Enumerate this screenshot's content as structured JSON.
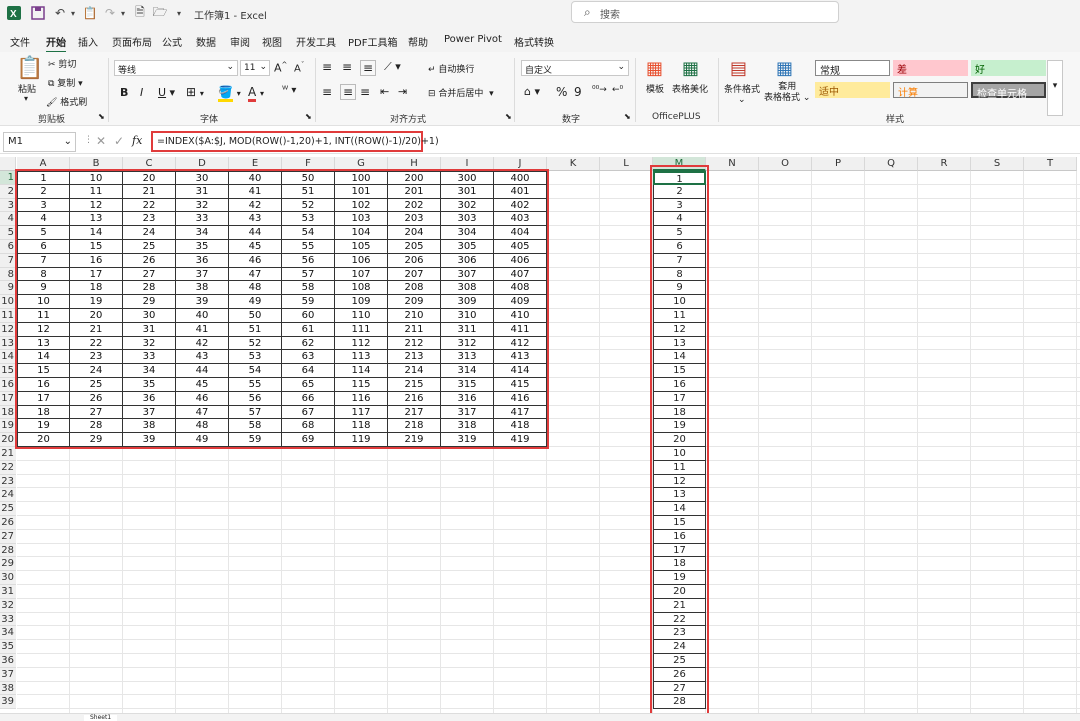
{
  "titlebar": {
    "title": "工作簿1 - Excel",
    "search_placeholder": "搜索",
    "icons": [
      "excel-logo",
      "save-icon",
      "undo-icon",
      "clipboard-icon",
      "redo-icon",
      "file-icon",
      "folder-icon",
      "chevron-down-icon"
    ]
  },
  "menu": [
    "文件",
    "开始",
    "插入",
    "页面布局",
    "公式",
    "数据",
    "审阅",
    "视图",
    "开发工具",
    "PDF工具箱",
    "帮助",
    "Power Pivot",
    "格式转换"
  ],
  "ribbon": {
    "clipboard": {
      "paste": "粘贴",
      "cut": "剪切",
      "copy": "复制",
      "format_painter": "格式刷",
      "label": "剪贴板"
    },
    "font": {
      "name": "等线",
      "size": "11",
      "label": "字体",
      "bold": "B",
      "italic": "I",
      "underline": "U"
    },
    "align": {
      "wrap": "自动换行",
      "merge": "合并后居中",
      "label": "对齐方式"
    },
    "number": {
      "format": "自定义",
      "label": "数字",
      "percent": "%",
      "comma": "9"
    },
    "officeplus": {
      "template": "模板",
      "beautify": "表格美化",
      "label": "OfficePLUS"
    },
    "styles": {
      "cond_format": "条件格式",
      "table_format_1": "套用",
      "table_format_2": "表格格式",
      "label": "样式",
      "items": [
        {
          "text": "常规",
          "bg": "#ffffff",
          "color": "#222222"
        },
        {
          "text": "差",
          "bg": "#ffc7ce",
          "color": "#9c0006"
        },
        {
          "text": "好",
          "bg": "#c6efce",
          "color": "#006100"
        },
        {
          "text": "适中",
          "bg": "#ffeb9c",
          "color": "#9c5700"
        },
        {
          "text": "计算",
          "bg": "#f2f2f2",
          "color": "#fa7d00"
        },
        {
          "text": "检查单元格",
          "bg": "#a5a5a5",
          "color": "#ffffff"
        }
      ]
    }
  },
  "formula": {
    "namebox": "M1",
    "fx": "fx",
    "content": "=INDEX($A:$J, MOD(ROW()-1,20)+1, INT((ROW()-1)/20)+1)"
  },
  "columns": [
    "A",
    "B",
    "C",
    "D",
    "E",
    "F",
    "G",
    "H",
    "I",
    "J",
    "K",
    "L",
    "M",
    "N",
    "O",
    "P",
    "Q",
    "R",
    "S",
    "T"
  ],
  "table": {
    "A": [
      1,
      2,
      3,
      4,
      5,
      6,
      7,
      8,
      9,
      10,
      11,
      12,
      13,
      14,
      15,
      16,
      17,
      18,
      19,
      20
    ],
    "B": [
      10,
      11,
      12,
      13,
      14,
      15,
      16,
      17,
      18,
      19,
      20,
      21,
      22,
      23,
      24,
      25,
      26,
      27,
      28,
      29
    ],
    "C": [
      20,
      21,
      22,
      23,
      24,
      25,
      26,
      27,
      28,
      29,
      30,
      31,
      32,
      33,
      34,
      35,
      36,
      37,
      38,
      39
    ],
    "D": [
      30,
      31,
      32,
      33,
      34,
      35,
      36,
      37,
      38,
      39,
      40,
      41,
      42,
      43,
      44,
      45,
      46,
      47,
      48,
      49
    ],
    "E": [
      40,
      41,
      42,
      43,
      44,
      45,
      46,
      47,
      48,
      49,
      50,
      51,
      52,
      53,
      54,
      55,
      56,
      57,
      58,
      59
    ],
    "F": [
      50,
      51,
      52,
      53,
      54,
      55,
      56,
      57,
      58,
      59,
      60,
      61,
      62,
      63,
      64,
      65,
      66,
      67,
      68,
      69
    ],
    "G": [
      100,
      101,
      102,
      103,
      104,
      105,
      106,
      107,
      108,
      109,
      110,
      111,
      112,
      113,
      114,
      115,
      116,
      117,
      118,
      119
    ],
    "H": [
      200,
      201,
      202,
      203,
      204,
      205,
      206,
      207,
      208,
      209,
      210,
      211,
      212,
      213,
      214,
      215,
      216,
      217,
      218,
      219
    ],
    "I": [
      300,
      301,
      302,
      303,
      304,
      305,
      306,
      307,
      308,
      309,
      310,
      311,
      312,
      313,
      314,
      315,
      316,
      317,
      318,
      319
    ],
    "J": [
      400,
      401,
      402,
      403,
      404,
      405,
      406,
      407,
      408,
      409,
      410,
      411,
      412,
      413,
      414,
      415,
      416,
      417,
      418,
      419
    ]
  },
  "columnM": [
    1,
    2,
    3,
    4,
    5,
    6,
    7,
    8,
    9,
    10,
    11,
    12,
    13,
    14,
    15,
    16,
    17,
    18,
    19,
    20,
    10,
    11,
    12,
    13,
    14,
    15,
    16,
    17,
    18,
    19,
    20,
    21,
    22,
    23,
    24,
    25,
    26,
    27,
    28
  ],
  "sheet": "Sheet1"
}
